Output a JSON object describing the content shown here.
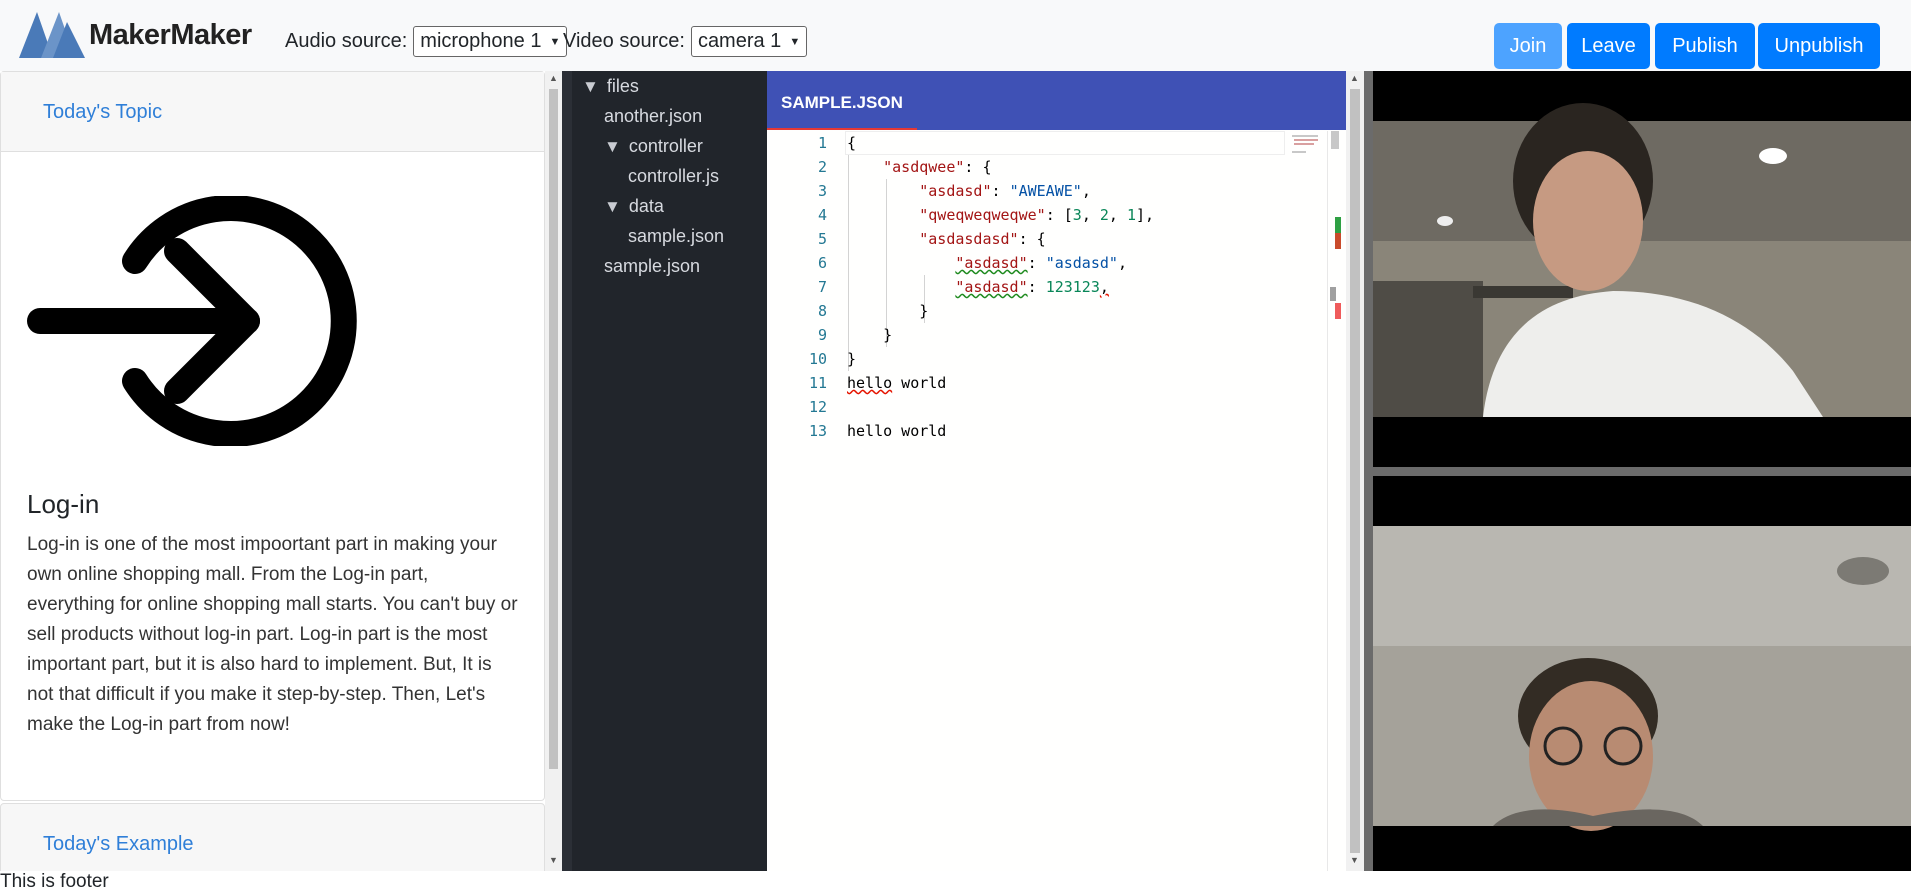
{
  "app": {
    "name": "MakerMaker"
  },
  "header": {
    "audio_label": "Audio source:",
    "audio_value": "microphone 1",
    "video_label": "Video source:",
    "video_value": "camera 1",
    "buttons": {
      "join": "Join",
      "leave": "Leave",
      "publish": "Publish",
      "unpublish": "Unpublish"
    },
    "colors": {
      "primary": "#007bff",
      "join_active": "#4da3ff"
    }
  },
  "lesson": {
    "topic_header": "Today's Topic",
    "icon": "login-icon",
    "title": "Log-in",
    "text": "Log-in is one of the most impoortant part in making your own online shopping mall. From the Log-in part, everything for online shopping mall starts. You can't buy or sell products without log-in part. Log-in part is the most important part, but it is also hard to implement. But, It is not that difficult if you make it step-by-step. Then, Let's make the Log-in part from now!",
    "example_header": "Today's Example"
  },
  "file_tree": {
    "root": "files",
    "items": [
      "another.json",
      "controller",
      "controller.js",
      "data",
      "sample.json",
      "sample.json"
    ]
  },
  "editor": {
    "tab": "SAMPLE.JSON",
    "line_numbers": [
      "1",
      "2",
      "3",
      "4",
      "5",
      "6",
      "7",
      "8",
      "9",
      "10",
      "11",
      "12",
      "13"
    ],
    "code": {
      "l1": "{",
      "l2_key": "\"asdqwee\"",
      "l2_rest": ": {",
      "l3_key": "\"asdasd\"",
      "l3_colon": ": ",
      "l3_val": "\"AWEAWE\"",
      "l3_end": ",",
      "l4_key": "\"qweqweqweqwe\"",
      "l4_a": ": [",
      "l4_n1": "3",
      "l4_c1": ", ",
      "l4_n2": "2",
      "l4_c2": ", ",
      "l4_n3": "1",
      "l4_end": "],",
      "l5_key": "\"asdasdasd\"",
      "l5_rest": ": {",
      "l6_key": "\"asdasd\"",
      "l6_colon": ": ",
      "l6_val": "\"asdasd\"",
      "l6_end": ",",
      "l7_key": "\"asdasd\"",
      "l7_colon": ": ",
      "l7_val": "123123",
      "l7_end": ",",
      "l8": "}",
      "l9": "}",
      "l10": "}",
      "l11_a": "hello",
      "l11_b": " world",
      "l13": "hello world"
    }
  },
  "footer": {
    "text": "This is footer"
  }
}
